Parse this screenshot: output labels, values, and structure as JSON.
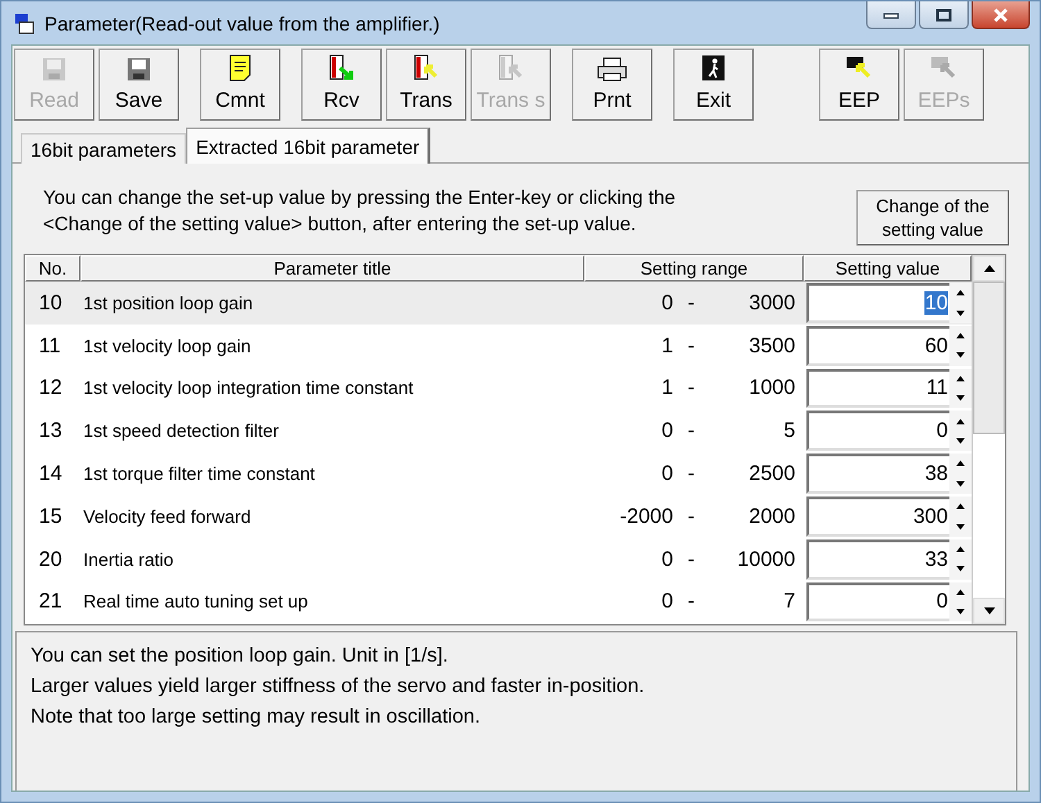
{
  "window": {
    "title": "Parameter(Read-out value from the amplifier.)"
  },
  "toolbar": [
    [
      {
        "label": "Read",
        "kind": "disk",
        "disabled": true
      },
      {
        "label": "Save",
        "kind": "disk",
        "disabled": false
      }
    ],
    [
      {
        "label": "Cmnt",
        "kind": "note",
        "disabled": false
      }
    ],
    [
      {
        "label": "Rcv",
        "kind": "receive",
        "disabled": false
      },
      {
        "label": "Trans",
        "kind": "transmit",
        "disabled": false
      },
      {
        "label": "Trans s",
        "kind": "transmit",
        "disabled": true
      }
    ],
    [
      {
        "label": "Prnt",
        "kind": "printer",
        "disabled": false
      }
    ],
    [
      {
        "label": "Exit",
        "kind": "exit",
        "disabled": false
      }
    ],
    [
      {
        "label": "EEP",
        "kind": "eep",
        "disabled": false
      },
      {
        "label": "EEPs",
        "kind": "eep",
        "disabled": true
      }
    ]
  ],
  "tabs": [
    {
      "label": "16bit parameters",
      "selected": false
    },
    {
      "label": "Extracted 16bit parameter",
      "selected": true
    }
  ],
  "instruction": "You can change the set-up value by pressing the Enter-key or clicking the <Change of the setting value> button, after entering the set-up value.",
  "change_button": "Change of the setting value",
  "table": {
    "columns": [
      "No.",
      "Parameter title",
      "Setting range",
      "Setting value"
    ],
    "rows": [
      {
        "no": "10",
        "title": "1st position loop gain",
        "min": "0",
        "sep": "-",
        "max": "3000",
        "value": "10",
        "selected": true
      },
      {
        "no": "11",
        "title": "1st velocity loop gain",
        "min": "1",
        "sep": "-",
        "max": "3500",
        "value": "60",
        "selected": false
      },
      {
        "no": "12",
        "title": "1st velocity loop integration time constant",
        "min": "1",
        "sep": "-",
        "max": "1000",
        "value": "11",
        "selected": false
      },
      {
        "no": "13",
        "title": "1st speed detection filter",
        "min": "0",
        "sep": "-",
        "max": "5",
        "value": "0",
        "selected": false
      },
      {
        "no": "14",
        "title": "1st torque filter time constant",
        "min": "0",
        "sep": "-",
        "max": "2500",
        "value": "38",
        "selected": false
      },
      {
        "no": "15",
        "title": "Velocity feed forward",
        "min": "-2000",
        "sep": "-",
        "max": "2000",
        "value": "300",
        "selected": false
      },
      {
        "no": "20",
        "title": "Inertia ratio",
        "min": "0",
        "sep": "-",
        "max": "10000",
        "value": "33",
        "selected": false
      },
      {
        "no": "21",
        "title": "Real time auto tuning set up",
        "min": "0",
        "sep": "-",
        "max": "7",
        "value": "0",
        "selected": false
      }
    ]
  },
  "description": [
    "You can set the position loop gain. Unit in [1/s].",
    "Larger values yield larger stiffness of the servo and faster in-position.",
    "Note that too large setting may result in oscillation."
  ]
}
